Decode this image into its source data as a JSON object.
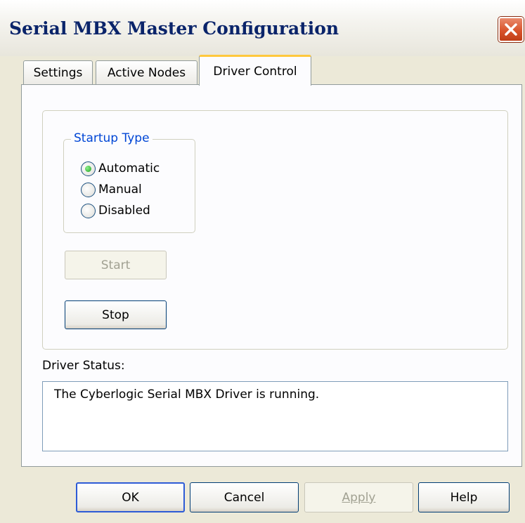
{
  "window": {
    "title": "Serial MBX Master Configuration",
    "close_icon": "close-icon"
  },
  "tabs": [
    {
      "label": "Settings",
      "selected": false
    },
    {
      "label": "Active Nodes",
      "selected": false
    },
    {
      "label": "Driver Control",
      "selected": true
    }
  ],
  "startup": {
    "group_label": "Startup Type",
    "options": [
      {
        "label": "Automatic",
        "checked": true
      },
      {
        "label": "Manual",
        "checked": false
      },
      {
        "label": "Disabled",
        "checked": false
      }
    ]
  },
  "controls": {
    "start_label": "Start",
    "start_enabled": false,
    "stop_label": "Stop",
    "stop_enabled": true
  },
  "status": {
    "label": "Driver Status:",
    "text": "The Cyberlogic Serial MBX Driver is running."
  },
  "buttons": {
    "ok": "OK",
    "cancel": "Cancel",
    "apply": "Apply",
    "apply_enabled": false,
    "help": "Help"
  },
  "colors": {
    "title_text": "#0a246a",
    "group_label": "#0046d5",
    "tab_highlight": "#ffc83c",
    "close_button": "#d9542c"
  }
}
